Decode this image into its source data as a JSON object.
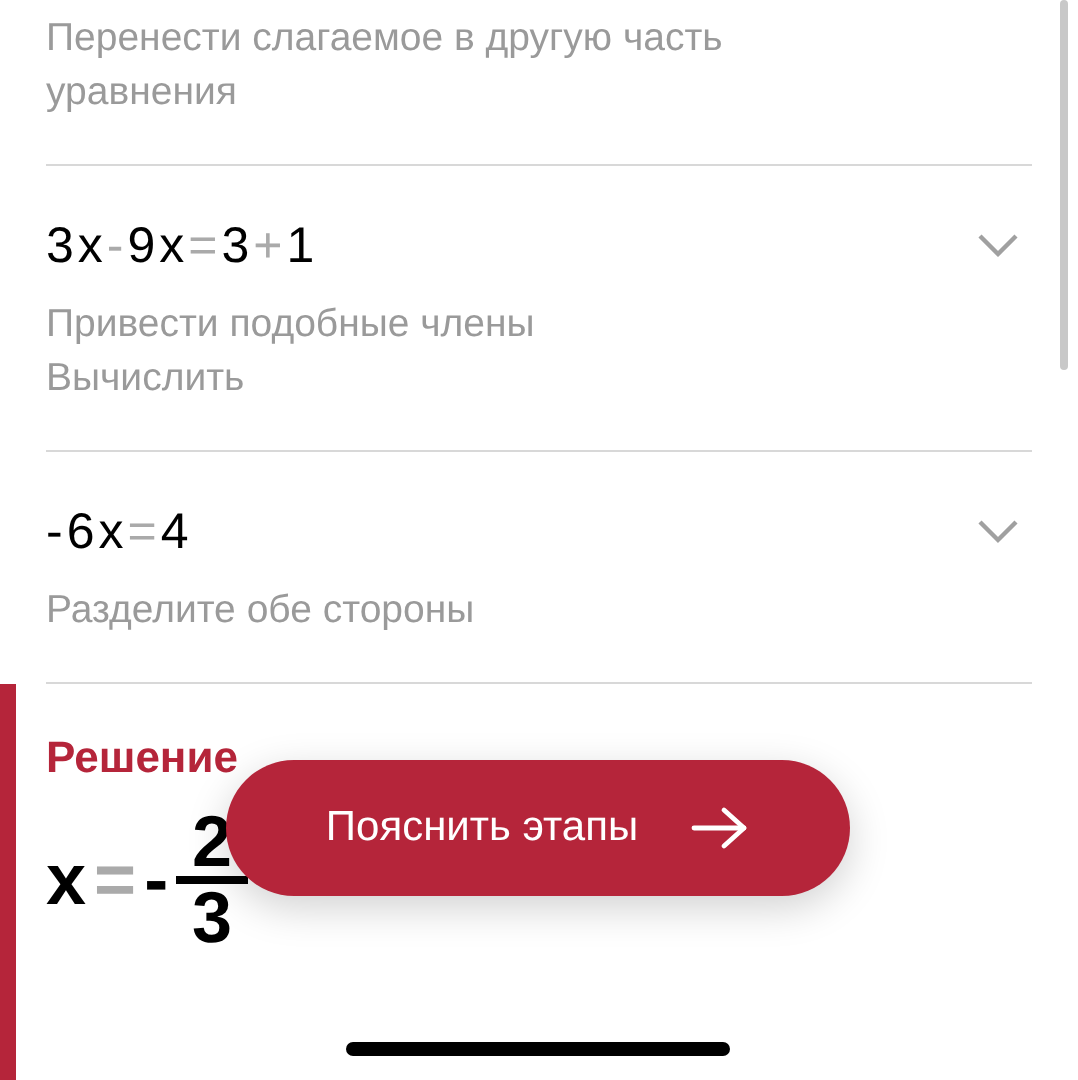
{
  "steps": [
    {
      "notes": [
        "Перенести слагаемое в другую часть уравнения"
      ]
    },
    {
      "expression": [
        {
          "kind": "term",
          "text": "3x"
        },
        {
          "kind": "op",
          "text": "-"
        },
        {
          "kind": "term",
          "text": "9x"
        },
        {
          "kind": "op",
          "text": "="
        },
        {
          "kind": "term",
          "text": "3"
        },
        {
          "kind": "op",
          "text": "+"
        },
        {
          "kind": "term",
          "text": "1"
        }
      ],
      "notes": [
        "Привести подобные члены",
        "Вычислить"
      ]
    },
    {
      "expression": [
        {
          "kind": "term",
          "text": "-6x"
        },
        {
          "kind": "op",
          "text": "="
        },
        {
          "kind": "term",
          "text": "4"
        }
      ],
      "notes": [
        "Разделите обе стороны"
      ]
    }
  ],
  "solution": {
    "title": "Решение",
    "answer": [
      {
        "kind": "term",
        "text": "x"
      },
      {
        "kind": "op",
        "text": "="
      },
      {
        "kind": "term",
        "text": "-"
      },
      {
        "kind": "fraction",
        "numerator": "2",
        "denominator": "3"
      }
    ]
  },
  "action_button": {
    "label": "Пояснить этапы"
  }
}
